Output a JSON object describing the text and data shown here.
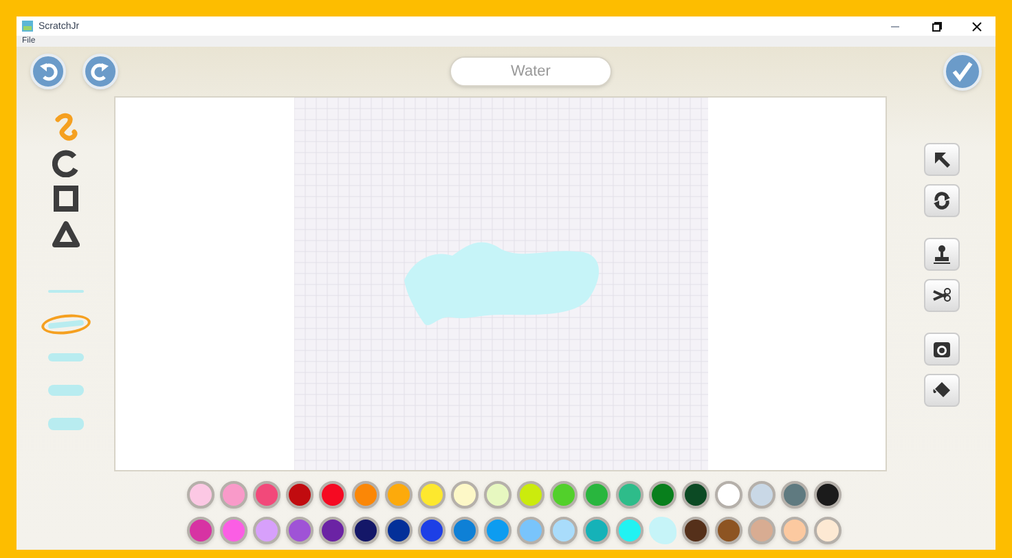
{
  "window": {
    "title": "ScratchJr"
  },
  "menu": [
    "File"
  ],
  "name_field": {
    "value": "Water"
  },
  "shape_tools": [
    {
      "kind": "freehand",
      "selected": true
    },
    {
      "kind": "circle",
      "selected": false
    },
    {
      "kind": "rectangle",
      "selected": false
    },
    {
      "kind": "triangle",
      "selected": false
    }
  ],
  "line_widths": [
    {
      "selected": false
    },
    {
      "selected": true
    },
    {
      "selected": false
    },
    {
      "selected": false
    },
    {
      "selected": false
    }
  ],
  "palette": [
    {
      "color": "#fcc8e4",
      "selected": false
    },
    {
      "color": "#f99ac9",
      "selected": false
    },
    {
      "color": "#f2497a",
      "selected": false
    },
    {
      "color": "#c10b0f",
      "selected": false
    },
    {
      "color": "#f50a22",
      "selected": false
    },
    {
      "color": "#fb8706",
      "selected": false
    },
    {
      "color": "#fdaa0b",
      "selected": false
    },
    {
      "color": "#fde82e",
      "selected": false
    },
    {
      "color": "#fdf8c7",
      "selected": false
    },
    {
      "color": "#e7f8c0",
      "selected": false
    },
    {
      "color": "#cbeb0d",
      "selected": false
    },
    {
      "color": "#52d02b",
      "selected": false
    },
    {
      "color": "#29b63e",
      "selected": false
    },
    {
      "color": "#2ebc8a",
      "selected": false
    },
    {
      "color": "#087f1c",
      "selected": false
    },
    {
      "color": "#0c4a24",
      "selected": false
    },
    {
      "color": "#ffffff",
      "selected": false
    },
    {
      "color": "#c9d8e6",
      "selected": false
    },
    {
      "color": "#5f7a80",
      "selected": false
    },
    {
      "color": "#1b1b1b",
      "selected": false
    },
    {
      "color": "#d733a3",
      "selected": false
    },
    {
      "color": "#fb5ee4",
      "selected": false
    },
    {
      "color": "#d7a0fb",
      "selected": false
    },
    {
      "color": "#9f53d6",
      "selected": false
    },
    {
      "color": "#6b23a4",
      "selected": false
    },
    {
      "color": "#141768",
      "selected": false
    },
    {
      "color": "#033099",
      "selected": false
    },
    {
      "color": "#1d3fe6",
      "selected": false
    },
    {
      "color": "#0e80d6",
      "selected": false
    },
    {
      "color": "#0d9cf0",
      "selected": false
    },
    {
      "color": "#79c4fb",
      "selected": false
    },
    {
      "color": "#a9dcfb",
      "selected": false
    },
    {
      "color": "#15b2b8",
      "selected": false
    },
    {
      "color": "#22f2f2",
      "selected": false
    },
    {
      "color": "#c6f4f8",
      "selected": true
    },
    {
      "color": "#55301a",
      "selected": false
    },
    {
      "color": "#8d5422",
      "selected": false
    },
    {
      "color": "#d8ac92",
      "selected": false
    },
    {
      "color": "#fcc9a0",
      "selected": false
    },
    {
      "color": "#fde9d3",
      "selected": false
    }
  ]
}
